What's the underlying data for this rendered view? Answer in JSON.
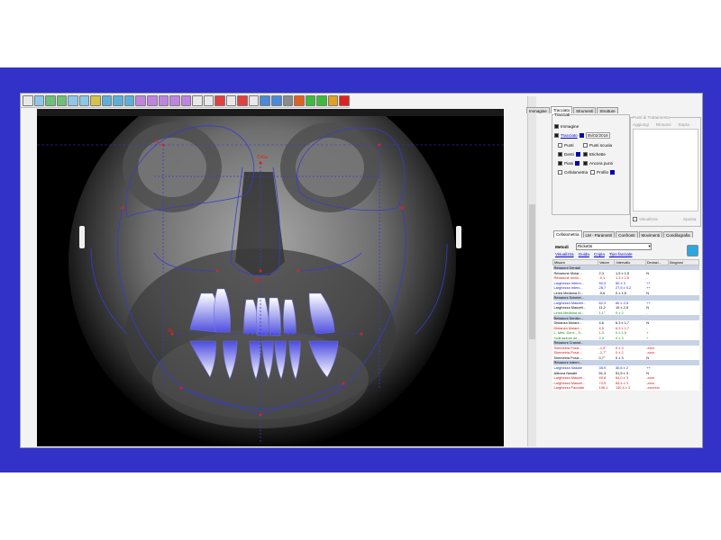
{
  "toolbar": {
    "buttons": [
      {
        "icon": "screen-icon",
        "color": "#e8e8e8"
      },
      {
        "icon": "arrow-icon",
        "color": "#8cc8e8"
      },
      {
        "icon": "undo-icon",
        "color": "#6cc07a"
      },
      {
        "icon": "redo-icon",
        "color": "#6cc07a"
      },
      {
        "icon": "angle-icon",
        "color": "#8cc8e8"
      },
      {
        "icon": "magic-icon",
        "color": "#8cc8e8"
      },
      {
        "icon": "brush-icon",
        "color": "#d4c44a"
      },
      {
        "icon": "ruler-icon",
        "color": "#5cb0d8"
      },
      {
        "icon": "line-icon",
        "color": "#5cb0d8"
      },
      {
        "icon": "point-icon",
        "color": "#5cb0d8"
      },
      {
        "icon": "move-icon",
        "color": "#c084e0"
      },
      {
        "icon": "rotate-icon",
        "color": "#c084e0"
      },
      {
        "icon": "flip-icon",
        "color": "#c084e0"
      },
      {
        "icon": "mirror-icon",
        "color": "#c084e0"
      },
      {
        "icon": "scale-icon",
        "color": "#c084e0"
      },
      {
        "icon": "cursor-icon",
        "color": "#e8e8e8"
      },
      {
        "icon": "pencil-icon",
        "color": "#e8e8e8"
      },
      {
        "icon": "shape-icon",
        "color": "#e04040"
      },
      {
        "icon": "cut-icon",
        "color": "#e8e8e8"
      },
      {
        "icon": "record-icon",
        "color": "#e04040"
      },
      {
        "icon": "sheet-icon",
        "color": "#e8e8e8"
      },
      {
        "icon": "save-icon",
        "color": "#4a8ad8"
      },
      {
        "icon": "save-as-icon",
        "color": "#4a8ad8"
      },
      {
        "icon": "print-icon",
        "color": "#8a8a8a"
      },
      {
        "icon": "pdf-icon",
        "color": "#e06020"
      },
      {
        "icon": "check-icon",
        "color": "#3cbc3c"
      },
      {
        "icon": "ok-icon",
        "color": "#3cbc3c"
      },
      {
        "icon": "export-icon",
        "color": "#e0a020"
      },
      {
        "icon": "cancel-icon",
        "color": "#e02020"
      }
    ]
  },
  "tabs_top": [
    "Immagine",
    "Tracciato",
    "Strumenti",
    "Strutture"
  ],
  "tabs_top_active": 1,
  "tracciati": {
    "group_label": "Tracciati",
    "immagine": "Immagine",
    "tracciato": "Tracciato",
    "date": "05/02/2018",
    "punti": "Punti",
    "punti_scuola": "Punti scuola",
    "denti": "Denti",
    "etichette": "Etichette",
    "piani": "Piani",
    "ancora_punti": "Ancora punti",
    "cefalometria": "Cefalometria",
    "profilo": "Profilo"
  },
  "punti_tratt": {
    "group_label": "Punti di Trattamento",
    "cols": [
      "Aggiungi",
      "Rimuovi",
      "Sopra"
    ],
    "check": "Visualizza",
    "button": "Sposta"
  },
  "tabs_bottom": [
    "Cefalometria",
    "LM - Parametri",
    "Confronti",
    "Movimenti",
    "Condilografia"
  ],
  "tabs_bottom_active": 0,
  "metodi": {
    "label": "Metodi",
    "value": "Ricketts"
  },
  "links": [
    "Visualizza",
    "Guida",
    "Copia",
    "Tipo facciale"
  ],
  "table": {
    "headers": [
      "Misura",
      "Valore",
      "Intervallo",
      "Deviazi...",
      "Diagnosi"
    ],
    "rows": [
      {
        "type": "hdr",
        "cells": [
          "Relazioni Dentali",
          "",
          "",
          "",
          ""
        ]
      },
      {
        "type": "black",
        "cells": [
          "Relazione Molar...",
          "2,3",
          "1,5 ± 1,5",
          "N",
          ""
        ]
      },
      {
        "type": "red",
        "cells": [
          "Relazione Incisi...",
          "-0,1",
          "1,3 ± 1,5",
          "-",
          ""
        ]
      },
      {
        "type": "blue",
        "cells": [
          "Larghezza Interm...",
          "50,3",
          "50 ± 3",
          "++",
          ""
        ]
      },
      {
        "type": "blue",
        "cells": [
          "Larghezza Interc...",
          "28,7",
          "27,5 ± 0,2",
          "++",
          ""
        ]
      },
      {
        "type": "black",
        "cells": [
          "Linea Mediana D...",
          "-0,6",
          "0 ± 1,5",
          "N",
          ""
        ]
      },
      {
        "type": "hdr",
        "cells": [
          "Relazioni Schelet...",
          "",
          "",
          "",
          ""
        ]
      },
      {
        "type": "blue",
        "cells": [
          "Larghezza Mascell...",
          "62,3",
          "60 ± 2,5",
          "++",
          ""
        ]
      },
      {
        "type": "black",
        "cells": [
          "Larghezza Mascell...",
          "11,2",
          "10 ± 2,5",
          "N",
          ""
        ]
      },
      {
        "type": "green",
        "cells": [
          "Linea Mediana ck...",
          "1,1°",
          "0 ± 2",
          "-",
          ""
        ]
      },
      {
        "type": "hdr",
        "cells": [
          "Relazioni Denticr...",
          "",
          "",
          "",
          ""
        ]
      },
      {
        "type": "black",
        "cells": [
          "Distanza Molare...",
          "4,6",
          "6,3 ± 1,7",
          "N",
          ""
        ]
      },
      {
        "type": "red",
        "cells": [
          "Distanza Molare...",
          "4,5",
          "6,3 ± 1,7",
          "-",
          ""
        ]
      },
      {
        "type": "green",
        "cells": [
          "L. Med. Dent. - S...",
          "1,3",
          "0 ± 1,5",
          "+",
          ""
        ]
      },
      {
        "type": "green",
        "cells": [
          "Inclinazione de...",
          "2,3",
          "0 ± 3",
          "+",
          ""
        ]
      },
      {
        "type": "hdr",
        "cells": [
          "Relazioni Craniof...",
          "",
          "",
          "",
          ""
        ]
      },
      {
        "type": "red",
        "cells": [
          "Simmetria Posiz...",
          "-1,9°",
          "0 ± 3",
          "-xxxx",
          ""
        ]
      },
      {
        "type": "red",
        "cells": [
          "Simmetria Posiz...",
          "-1,7°",
          "0 ± 2",
          "-xxxx",
          ""
        ]
      },
      {
        "type": "black",
        "cells": [
          "Simmetria Posiz...",
          "0,7°",
          "0 ± 3",
          "N",
          ""
        ]
      },
      {
        "type": "hdr",
        "cells": [
          "Relazioni Interm...",
          "",
          "",
          "",
          ""
        ]
      },
      {
        "type": "blue",
        "cells": [
          "Larghezza Nasale",
          "35,9",
          "30,6 ± 2",
          "++",
          ""
        ]
      },
      {
        "type": "black",
        "cells": [
          "Altezza Nasale",
          "51,3",
          "51,5 ± 3",
          "N",
          ""
        ]
      },
      {
        "type": "red",
        "cells": [
          "Larghezza Mascel...",
          "49,8",
          "64,0 ± 3",
          "-xxxx",
          ""
        ]
      },
      {
        "type": "red",
        "cells": [
          "Larghezza Mascel...",
          "70,5",
          "84,4 ± 3",
          "-xxxx",
          ""
        ]
      },
      {
        "type": "red",
        "cells": [
          "Larghezza Facciale",
          "106,1",
          "130,4 ± 3",
          "-xxxxxxx",
          ""
        ]
      }
    ]
  },
  "xray_labels": {
    "or1": "Or",
    "cr": "CrGa",
    "ans": "ANS",
    "mx": "Mx"
  },
  "colors": {
    "background_band": "#3232c8",
    "trace_line": "#3a3ad0",
    "landmark": "#e02020"
  }
}
